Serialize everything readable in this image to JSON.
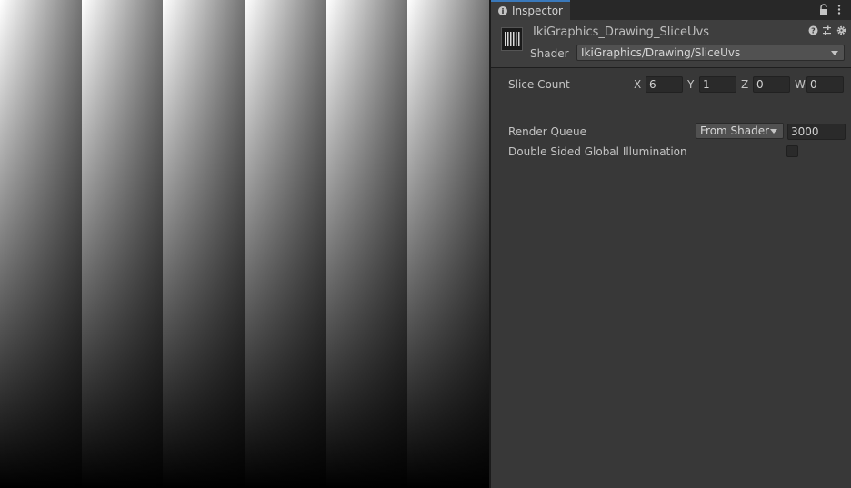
{
  "scene": {
    "slice_count": 6
  },
  "inspector": {
    "tab_label": "Inspector",
    "material_name": "IkiGraphics_Drawing_SliceUvs",
    "shader_label": "Shader",
    "shader_value": "IkiGraphics/Drawing/SliceUvs"
  },
  "properties": {
    "slice_count": {
      "label": "Slice Count",
      "x_label": "X",
      "x": "6",
      "y_label": "Y",
      "y": "1",
      "z_label": "Z",
      "z": "0",
      "w_label": "W",
      "w": "0"
    },
    "render_queue": {
      "label": "Render Queue",
      "mode": "From Shader",
      "value": "3000"
    },
    "double_sided_gi": {
      "label": "Double Sided Global Illumination",
      "checked": false
    }
  },
  "colors": {
    "accent": "#3a79bb",
    "panel_bg": "#383838",
    "field_bg": "#2a2a2a"
  }
}
